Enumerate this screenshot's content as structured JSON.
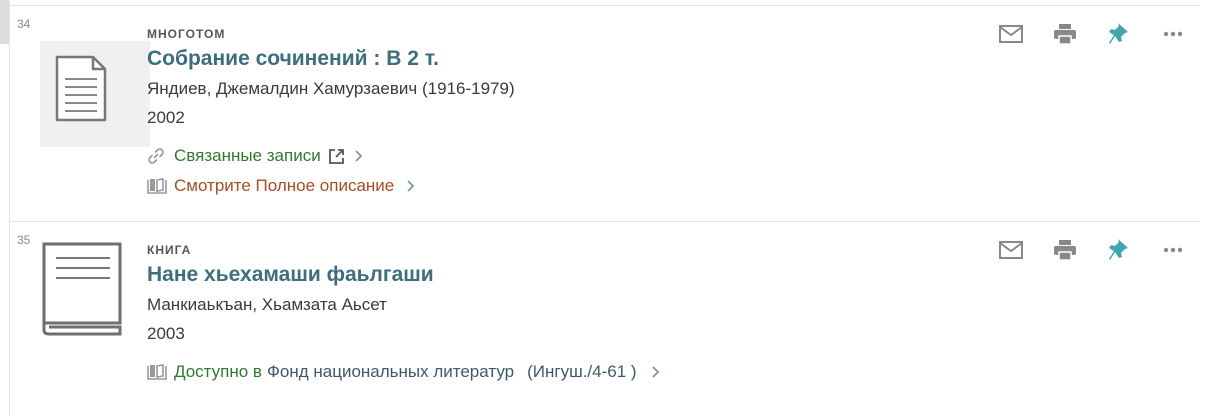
{
  "results": [
    {
      "number": "34",
      "type": "МНОГОТОМ",
      "title": "Собрание сочинений : В 2 т.",
      "author": "Яндиев, Джемалдин Хамурзаевич (1916-1979)",
      "year": "2002",
      "related_link": "Связанные записи",
      "full_desc_link": "Смотрите Полное описание",
      "thumb_icon": "document-icon"
    },
    {
      "number": "35",
      "type": "КНИГА",
      "title": "Нане хьехамаши фаьлгаши",
      "author": "Манкиаькъан, Хьамзата Аьсет",
      "year": "2003",
      "availability_prefix": "Доступно в",
      "availability_location": "Фонд национальных литератур",
      "availability_callnumber": "(Ингуш./4-61 )",
      "thumb_icon": "book-icon"
    }
  ],
  "actions": [
    "email-icon",
    "print-icon",
    "pin-icon",
    "more-icon"
  ],
  "colors": {
    "title": "#3d6e7e",
    "green_link": "#2f7a2e",
    "brown_link": "#a64d22",
    "icon_grey": "#888888",
    "pin_teal": "#3fa6ae"
  }
}
